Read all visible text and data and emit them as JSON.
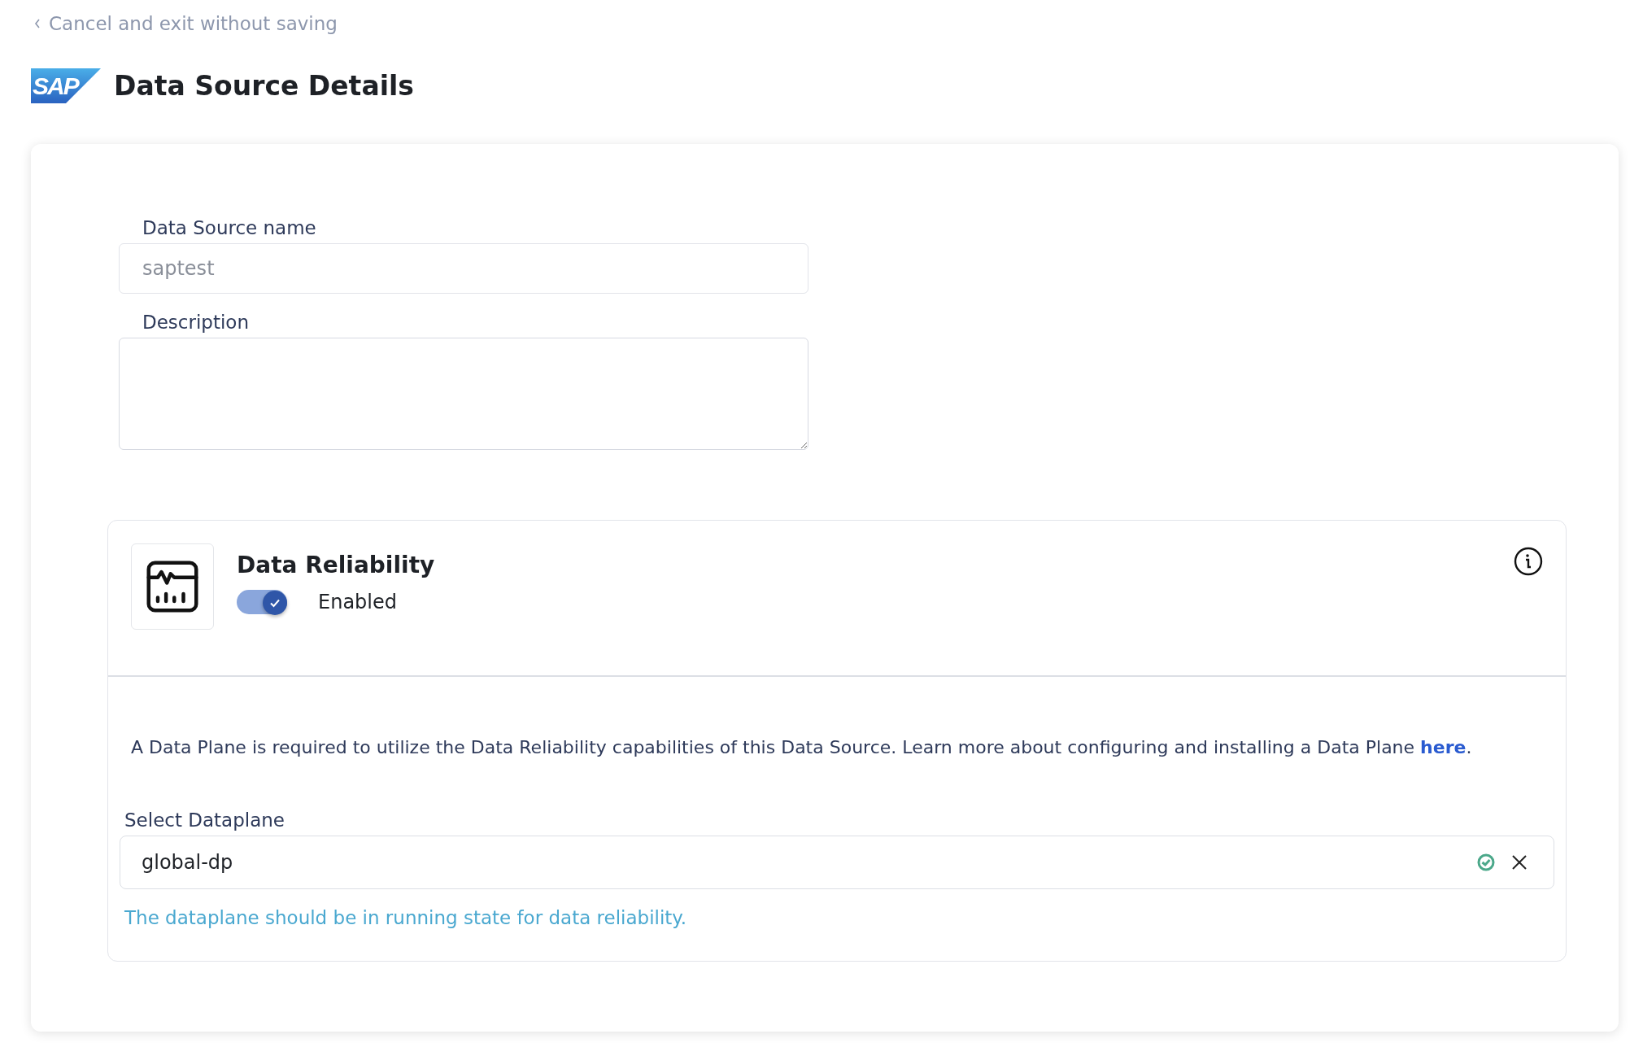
{
  "back_link": {
    "label": "Cancel and exit without saving"
  },
  "header": {
    "logo": "SAP",
    "title": "Data Source Details"
  },
  "form": {
    "name": {
      "label": "Data Source name",
      "value": "saptest"
    },
    "description": {
      "label": "Description"
    }
  },
  "reliability": {
    "title": "Data Reliability",
    "toggle": {
      "on": true,
      "label": "Enabled"
    },
    "notice": {
      "before": "A Data Plane is required to utilize the Data Reliability capabilities of this Data Source. Learn more about configuring and installing a Data Plane ",
      "link": "here",
      "after": "."
    },
    "dataplane": {
      "label": "Select Dataplane",
      "value": "global-dp",
      "valid": true,
      "hint": "The dataplane should be in running state for data reliability."
    }
  }
}
